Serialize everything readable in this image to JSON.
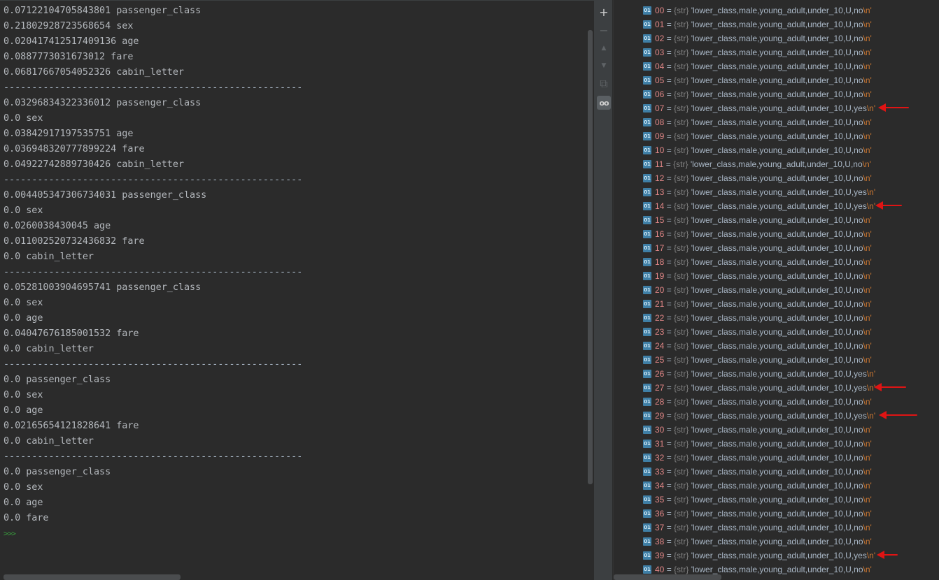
{
  "console": {
    "lines": [
      {
        "text": "0.07122104705843801 passenger_class"
      },
      {
        "text": "0.21802928723568654 sex"
      },
      {
        "text": "0.020417412517409136 age"
      },
      {
        "text": "0.0887773031673012 fare"
      },
      {
        "text": "0.06817667054052326 cabin_letter"
      },
      {
        "text": "-----------------------------------------------------",
        "sep": true
      },
      {
        "text": "0.03296834322336012 passenger_class"
      },
      {
        "text": "0.0 sex"
      },
      {
        "text": "0.03842917197535751 age"
      },
      {
        "text": "0.036948320777899224 fare"
      },
      {
        "text": "0.04922742889730426 cabin_letter"
      },
      {
        "text": "-----------------------------------------------------",
        "sep": true
      },
      {
        "text": "0.004405347306734031 passenger_class"
      },
      {
        "text": "0.0 sex"
      },
      {
        "text": "0.0260038430045 age"
      },
      {
        "text": "0.011002520732436832 fare"
      },
      {
        "text": "0.0 cabin_letter"
      },
      {
        "text": "-----------------------------------------------------",
        "sep": true
      },
      {
        "text": "0.05281003904695741 passenger_class"
      },
      {
        "text": "0.0 sex"
      },
      {
        "text": "0.0 age"
      },
      {
        "text": "0.04047676185001532 fare"
      },
      {
        "text": "0.0 cabin_letter"
      },
      {
        "text": "-----------------------------------------------------",
        "sep": true
      },
      {
        "text": "0.0 passenger_class"
      },
      {
        "text": "0.0 sex"
      },
      {
        "text": "0.0 age"
      },
      {
        "text": "0.02165654121828641 fare"
      },
      {
        "text": "0.0 cabin_letter"
      },
      {
        "text": "-----------------------------------------------------",
        "sep": true
      },
      {
        "text": "0.0 passenger_class"
      },
      {
        "text": "0.0 sex"
      },
      {
        "text": "0.0 age"
      },
      {
        "text": "0.0 fare"
      }
    ],
    "prompt": ">>>"
  },
  "toolbar": {
    "buttons": [
      {
        "icon": "plus-icon",
        "glyph": "+",
        "dim": false
      },
      {
        "icon": "minus-icon",
        "glyph": "−",
        "dim": true
      },
      {
        "icon": "arrow-up-icon",
        "glyph": "▲",
        "dim": true
      },
      {
        "icon": "arrow-down-icon",
        "glyph": "▼",
        "dim": true
      },
      {
        "icon": "copy-icon",
        "glyph": "⧉",
        "dim": true
      },
      {
        "icon": "glasses-icon",
        "glyph": "oo",
        "dim": false,
        "active": true
      }
    ]
  },
  "variables": {
    "icon_text": "01",
    "equals": " = ",
    "type": "{str} ",
    "escape": "\\n'",
    "items": [
      {
        "index": "00",
        "value": "'lower_class,male,young_adult,under_10,U,no"
      },
      {
        "index": "01",
        "value": "'lower_class,male,young_adult,under_10,U,no"
      },
      {
        "index": "02",
        "value": "'lower_class,male,young_adult,under_10,U,no"
      },
      {
        "index": "03",
        "value": "'lower_class,male,young_adult,under_10,U,no"
      },
      {
        "index": "04",
        "value": "'lower_class,male,young_adult,under_10,U,no"
      },
      {
        "index": "05",
        "value": "'lower_class,male,young_adult,under_10,U,no"
      },
      {
        "index": "06",
        "value": "'lower_class,male,young_adult,under_10,U,no"
      },
      {
        "index": "07",
        "value": "'lower_class,male,young_adult,under_10,U,yes",
        "marked": true
      },
      {
        "index": "08",
        "value": "'lower_class,male,young_adult,under_10,U,no"
      },
      {
        "index": "09",
        "value": "'lower_class,male,young_adult,under_10,U,no"
      },
      {
        "index": "10",
        "value": "'lower_class,male,young_adult,under_10,U,no"
      },
      {
        "index": "11",
        "value": "'lower_class,male,young_adult,under_10,U,no"
      },
      {
        "index": "12",
        "value": "'lower_class,male,young_adult,under_10,U,no"
      },
      {
        "index": "13",
        "value": "'lower_class,male,young_adult,under_10,U,yes"
      },
      {
        "index": "14",
        "value": "'lower_class,male,young_adult,under_10,U,yes",
        "marked": true
      },
      {
        "index": "15",
        "value": "'lower_class,male,young_adult,under_10,U,no"
      },
      {
        "index": "16",
        "value": "'lower_class,male,young_adult,under_10,U,no"
      },
      {
        "index": "17",
        "value": "'lower_class,male,young_adult,under_10,U,no"
      },
      {
        "index": "18",
        "value": "'lower_class,male,young_adult,under_10,U,no"
      },
      {
        "index": "19",
        "value": "'lower_class,male,young_adult,under_10,U,no"
      },
      {
        "index": "20",
        "value": "'lower_class,male,young_adult,under_10,U,no"
      },
      {
        "index": "21",
        "value": "'lower_class,male,young_adult,under_10,U,no"
      },
      {
        "index": "22",
        "value": "'lower_class,male,young_adult,under_10,U,no"
      },
      {
        "index": "23",
        "value": "'lower_class,male,young_adult,under_10,U,no"
      },
      {
        "index": "24",
        "value": "'lower_class,male,young_adult,under_10,U,no"
      },
      {
        "index": "25",
        "value": "'lower_class,male,young_adult,under_10,U,no"
      },
      {
        "index": "26",
        "value": "'lower_class,male,young_adult,under_10,U,yes"
      },
      {
        "index": "27",
        "value": "'lower_class,male,young_adult,under_10,U,yes",
        "marked": true
      },
      {
        "index": "28",
        "value": "'lower_class,male,young_adult,under_10,U,no"
      },
      {
        "index": "29",
        "value": "'lower_class,male,young_adult,under_10,U,yes",
        "marked": true
      },
      {
        "index": "30",
        "value": "'lower_class,male,young_adult,under_10,U,no"
      },
      {
        "index": "31",
        "value": "'lower_class,male,young_adult,under_10,U,no"
      },
      {
        "index": "32",
        "value": "'lower_class,male,young_adult,under_10,U,no"
      },
      {
        "index": "33",
        "value": "'lower_class,male,young_adult,under_10,U,no"
      },
      {
        "index": "34",
        "value": "'lower_class,male,young_adult,under_10,U,no"
      },
      {
        "index": "35",
        "value": "'lower_class,male,young_adult,under_10,U,no"
      },
      {
        "index": "36",
        "value": "'lower_class,male,young_adult,under_10,U,no"
      },
      {
        "index": "37",
        "value": "'lower_class,male,young_adult,under_10,U,no"
      },
      {
        "index": "38",
        "value": "'lower_class,male,young_adult,under_10,U,no"
      },
      {
        "index": "39",
        "value": "'lower_class,male,young_adult,under_10,U,yes",
        "marked": true
      },
      {
        "index": "40",
        "value": "'lower_class,male,young_adult,under_10,U,no"
      }
    ]
  },
  "annotation_color": "#e01414"
}
